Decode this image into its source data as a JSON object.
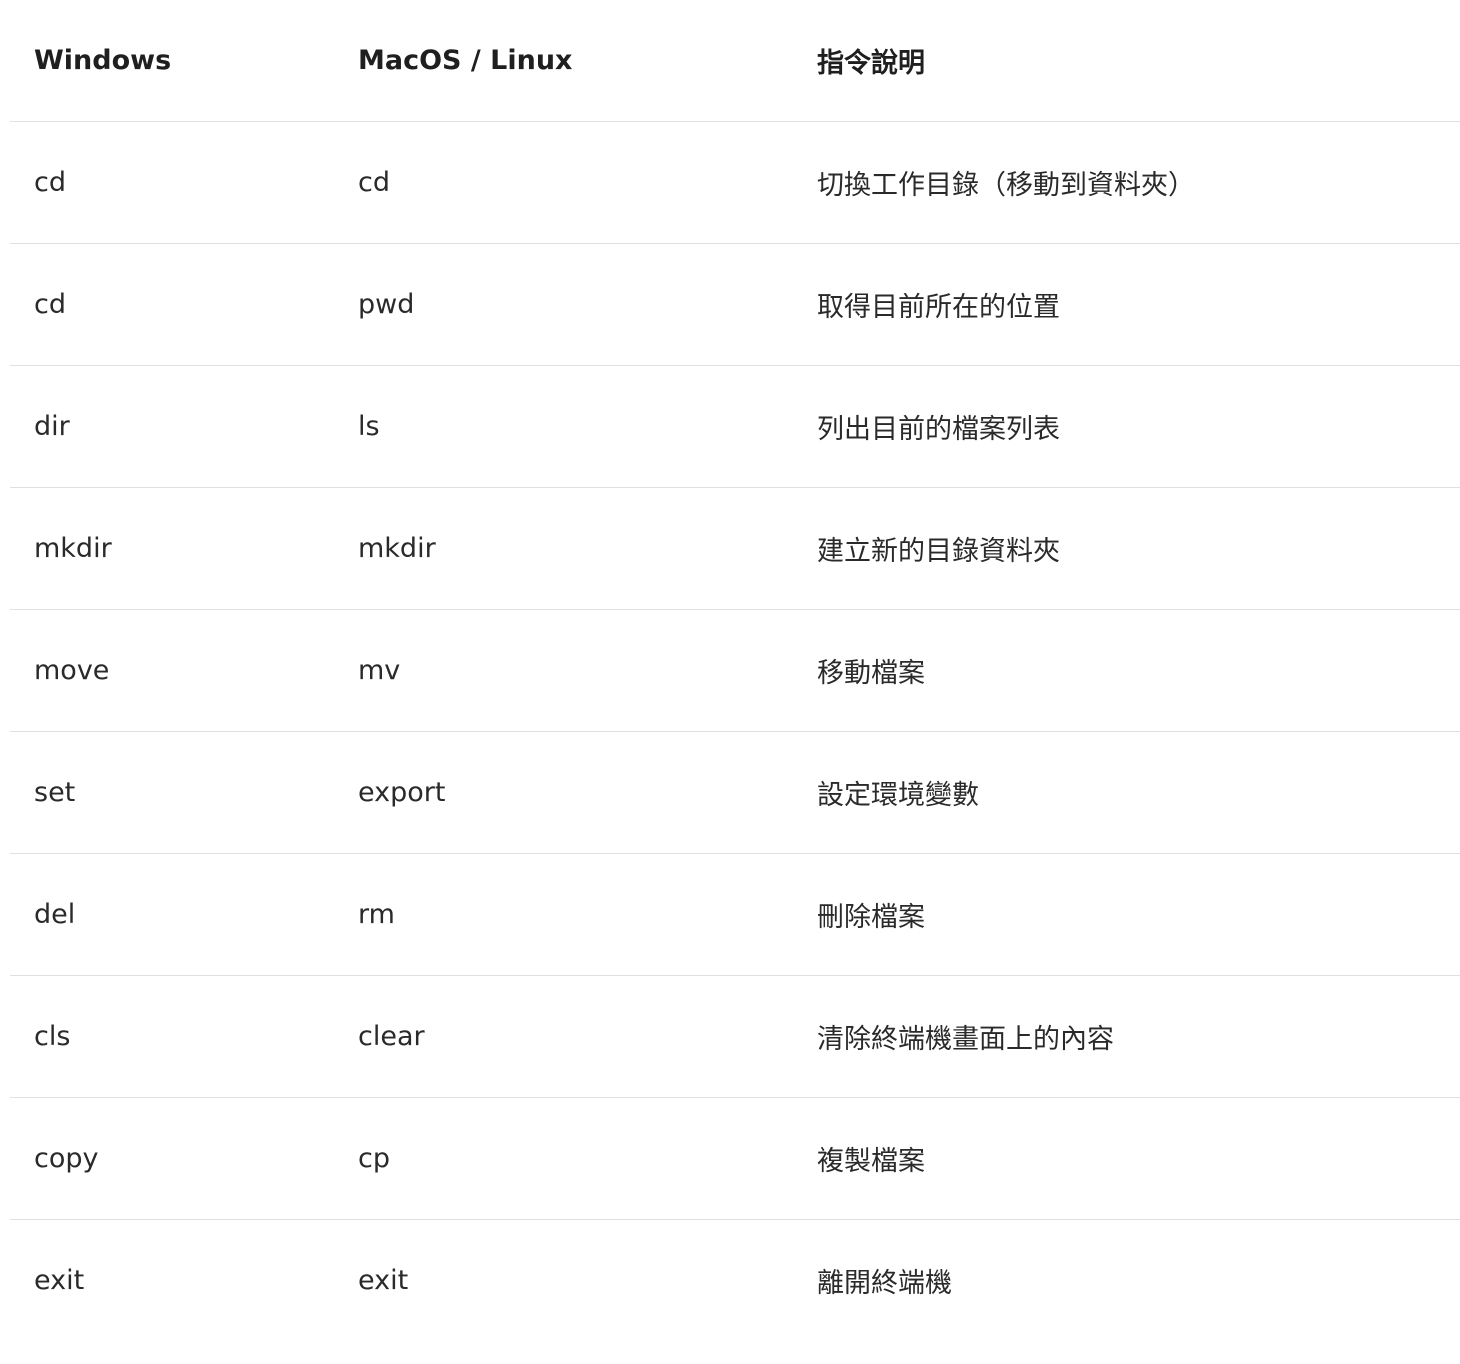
{
  "table": {
    "headers": [
      "Windows",
      "MacOS / Linux",
      "指令說明"
    ],
    "rows": [
      [
        "cd",
        "cd",
        "切換工作目錄（移動到資料夾）"
      ],
      [
        "cd",
        "pwd",
        "取得目前所在的位置"
      ],
      [
        "dir",
        "ls",
        "列出目前的檔案列表"
      ],
      [
        "mkdir",
        "mkdir",
        "建立新的目錄資料夾"
      ],
      [
        "move",
        "mv",
        "移動檔案"
      ],
      [
        "set",
        "export",
        "設定環境變數"
      ],
      [
        "del",
        "rm",
        "刪除檔案"
      ],
      [
        "cls",
        "clear",
        "清除終端機畫面上的內容"
      ],
      [
        "copy",
        "cp",
        "複製檔案"
      ],
      [
        "exit",
        "exit",
        "離開終端機"
      ]
    ]
  }
}
